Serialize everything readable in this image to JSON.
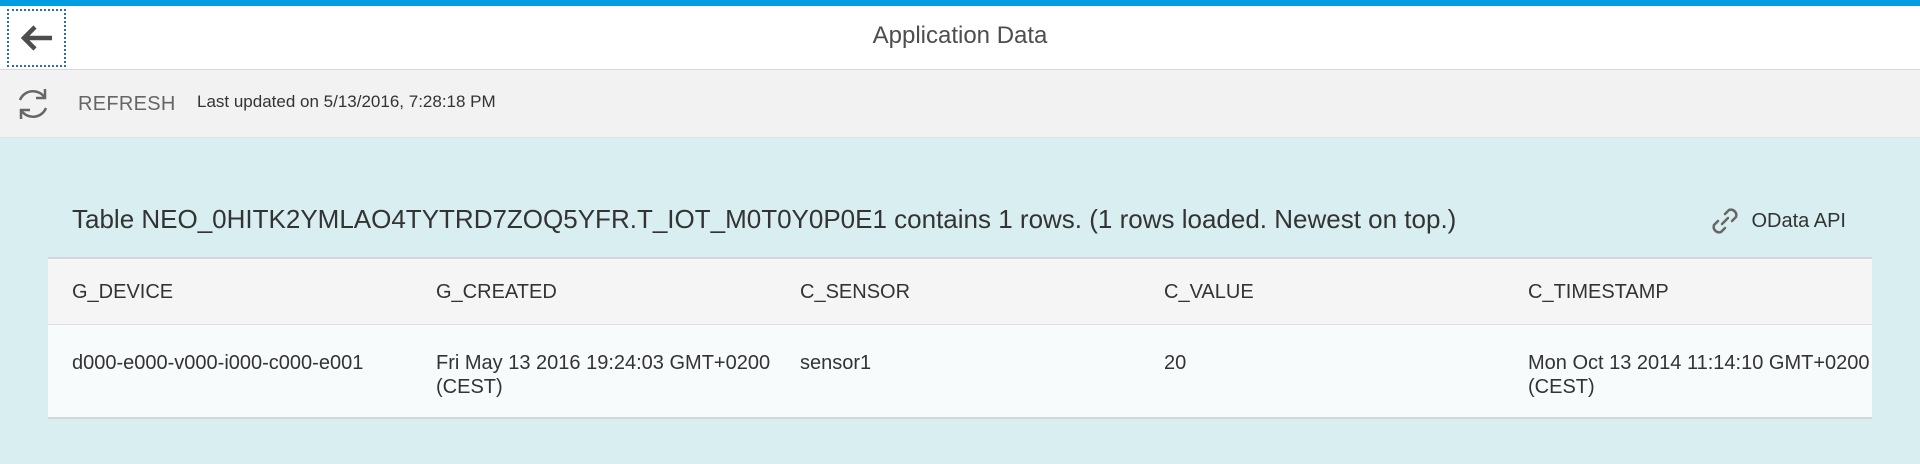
{
  "header": {
    "title": "Application Data",
    "back_icon": "arrow-left-icon"
  },
  "toolbar": {
    "refresh_label": "REFRESH",
    "refresh_icon": "refresh-icon",
    "last_updated": "Last updated on 5/13/2016, 7:28:18 PM"
  },
  "table_section": {
    "caption": "Table NEO_0HITK2YMLAO4TYTRD7ZOQ5YFR.T_IOT_M0T0Y0P0E1 contains 1 rows. (1 rows loaded. Newest on top.)",
    "odata_label": "OData API",
    "odata_icon": "link-icon",
    "columns": [
      "G_DEVICE",
      "G_CREATED",
      "C_SENSOR",
      "C_VALUE",
      "C_TIMESTAMP"
    ],
    "rows": [
      [
        "d000-e000-v000-i000-c000-e001",
        "Fri May 13 2016 19:24:03 GMT+0200 (CEST)",
        "sensor1",
        "20",
        "Mon Oct 13 2014 11:14:10 GMT+0200 (CEST)"
      ]
    ]
  },
  "colors": {
    "accent_bar": "#009de0",
    "content_background": "#d8eef0",
    "toolbar_background": "#f2f2f2"
  }
}
